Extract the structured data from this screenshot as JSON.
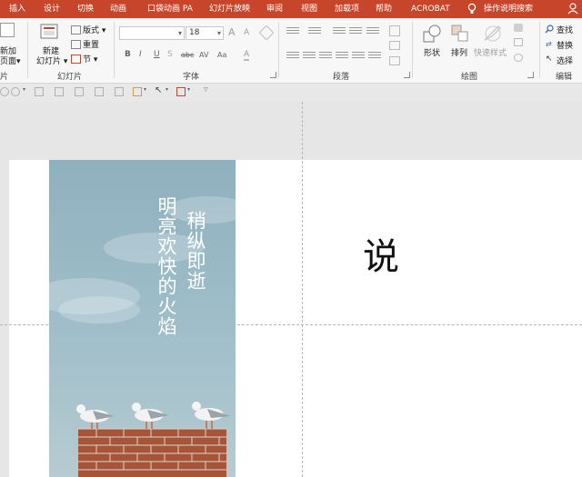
{
  "ribbon_tabs": [
    "插入",
    "设计",
    "切换",
    "动画",
    "口袋动画 PA",
    "幻灯片放映",
    "审阅",
    "视图",
    "加载项",
    "帮助",
    "ACROBAT",
    "操作说明搜索"
  ],
  "ribbon": {
    "slides_group": {
      "new_slide_partial_line1": "新加",
      "new_slide_partial_line2": "页面▾",
      "new_slide_line1": "新建",
      "new_slide_line2": "幻灯片 ▾",
      "layout": "版式 ▾",
      "reset": "重置",
      "section": "节 ▾",
      "group_label": "幻灯片",
      "left_partial_label": "片"
    },
    "font_group": {
      "font_name": "",
      "font_size": "18",
      "grow": "A",
      "shrink": "A",
      "bold": "B",
      "italic": "I",
      "underline": "U",
      "strike": "S",
      "spacing": "abc",
      "char_spacing": "AV",
      "case": "Aa",
      "font_color": "A",
      "group_label": "字体"
    },
    "paragraph_group": {
      "group_label": "段落"
    },
    "drawing_group": {
      "shapes": "形状",
      "arrange": "排列",
      "quick_styles": "快速样式",
      "group_label": "绘图"
    },
    "editing_group": {
      "find": "查找",
      "replace": "替换",
      "select": "选择",
      "group_label": "编辑"
    }
  },
  "slide": {
    "poem_col1": "明亮欢快的火焰",
    "poem_col2": "稍纵即逝",
    "big_char": "说"
  },
  "colors": {
    "accent": "#c6452b",
    "ribbon_bg": "#f7f7f7",
    "canvas_bg": "#e6e6e6"
  }
}
